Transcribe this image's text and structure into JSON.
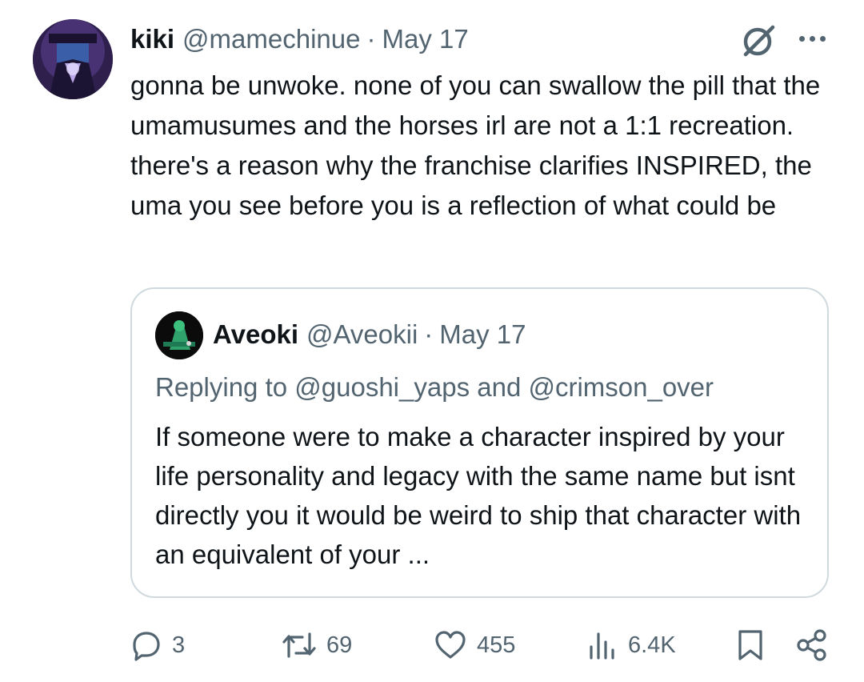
{
  "tweet": {
    "display_name": "kiki",
    "handle": "@mamechinue",
    "separator": "·",
    "date": "May 17",
    "text": "gonna be unwoke. none of you can swallow the pill that the umamusumes and the horses irl are not a 1:1 recreation. there's a reason why the franchise clarifies INSPIRED, the uma you see before you is a reflection of what could be"
  },
  "quoted": {
    "display_name": "Aveoki",
    "handle": "@Aveokii",
    "separator": "·",
    "date": "May 17",
    "replying_to": "Replying to @guoshi_yaps and @crimson_over",
    "text": "If someone were to make a character inspired by your life personality and legacy with the same name but isnt directly you it would be weird to ship that character with an equivalent of your ..."
  },
  "actions": {
    "replies": "3",
    "reposts": "69",
    "likes": "455",
    "views": "6.4K"
  },
  "icons": {
    "grok": "grok-icon",
    "more": "more-options-icon",
    "reply": "reply-icon",
    "repost": "repost-icon",
    "like": "heart-icon",
    "views": "views-chart-icon",
    "bookmark": "bookmark-icon",
    "share": "share-icon"
  },
  "colors": {
    "text": "#0f1419",
    "muted": "#536471",
    "border": "#cfd9de"
  }
}
